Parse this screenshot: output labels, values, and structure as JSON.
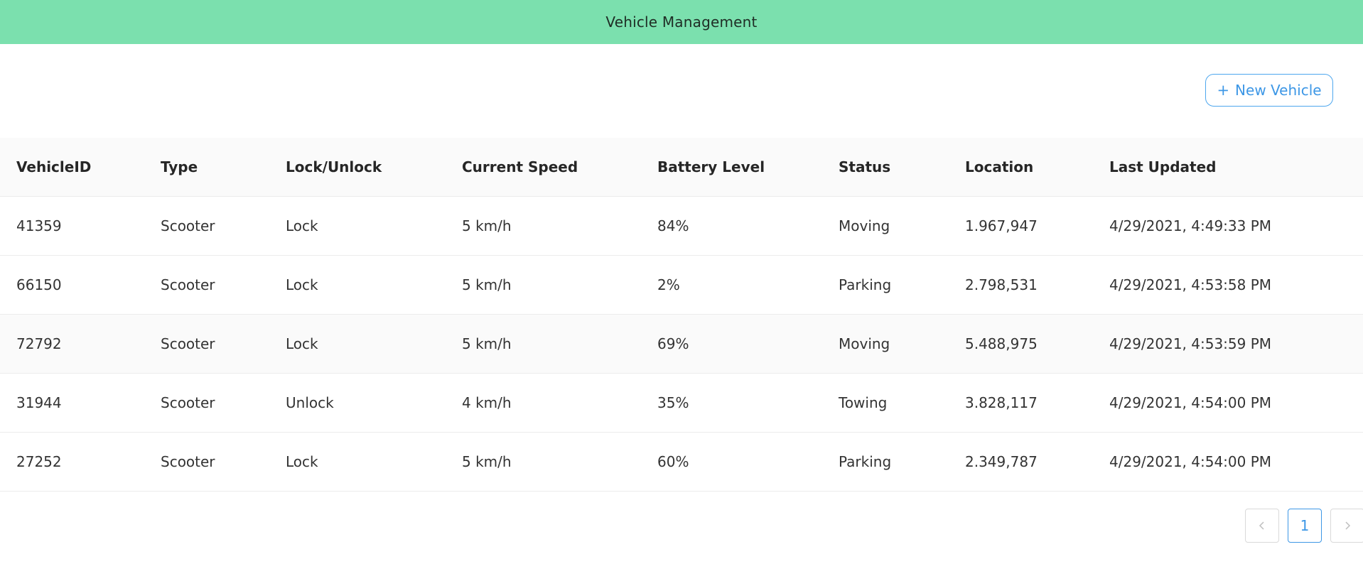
{
  "header": {
    "title": "Vehicle Management"
  },
  "toolbar": {
    "new_vehicle_plus": "+",
    "new_vehicle_label": "New Vehicle"
  },
  "table": {
    "columns": [
      "VehicleID",
      "Type",
      "Lock/Unlock",
      "Current Speed",
      "Battery Level",
      "Status",
      "Location",
      "Last Updated"
    ],
    "rows": [
      [
        "41359",
        "Scooter",
        "Lock",
        "5 km/h",
        "84%",
        "Moving",
        "1.967,947",
        "4/29/2021, 4:49:33 PM"
      ],
      [
        "66150",
        "Scooter",
        "Lock",
        "5 km/h",
        "2%",
        "Parking",
        "2.798,531",
        "4/29/2021, 4:53:58 PM"
      ],
      [
        "72792",
        "Scooter",
        "Lock",
        "5 km/h",
        "69%",
        "Moving",
        "5.488,975",
        "4/29/2021, 4:53:59 PM"
      ],
      [
        "31944",
        "Scooter",
        "Unlock",
        "4 km/h",
        "35%",
        "Towing",
        "3.828,117",
        "4/29/2021, 4:54:00 PM"
      ],
      [
        "27252",
        "Scooter",
        "Lock",
        "5 km/h",
        "60%",
        "Parking",
        "2.349,787",
        "4/29/2021, 4:54:00 PM"
      ]
    ]
  },
  "pagination": {
    "current_page": "1",
    "prev_icon": "chevron-left-icon",
    "next_icon": "chevron-right-icon"
  },
  "colors": {
    "header_bg": "#7be0ae",
    "accent": "#3d97e6"
  }
}
